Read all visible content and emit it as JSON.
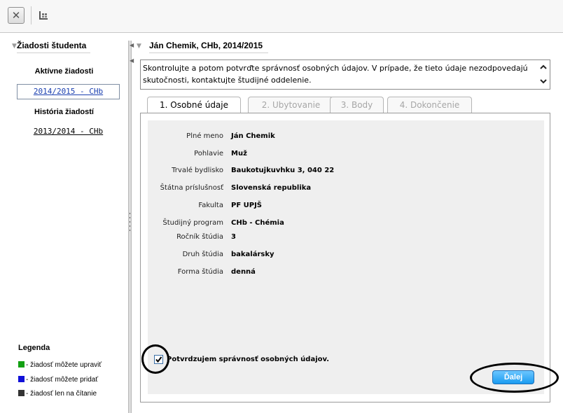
{
  "toolbar": {
    "close_icon": "close-icon",
    "grid_icon": "grid-icon"
  },
  "left": {
    "title": "Žiadosti študenta",
    "active_heading": "Aktívne žiadosti",
    "active_item": "2014/2015 - CHb",
    "history_heading": "História žiadostí",
    "history_item": "2013/2014 - CHb",
    "legend": {
      "title": "Legenda",
      "items": [
        {
          "color": "#12a012",
          "label": "- žiadosť  môžete upraviť"
        },
        {
          "color": "#1010d8",
          "label": "- žiadosť  môžete pridať"
        },
        {
          "color": "#333333",
          "label": "- žiadosť  len na čítanie"
        }
      ]
    }
  },
  "right": {
    "title": "Ján Chemik, CHb, 2014/2015",
    "info": "Skontrolujte a potom potvrďte správnosť osobných údajov. V prípade, že tieto údaje nezodpovedajú skutočnosti, kontaktujte študijné oddelenie.",
    "tabs": [
      "1. Osobné údaje",
      "2. Ubytovanie",
      "3. Body",
      "4. Dokončenie"
    ],
    "fields": [
      {
        "label": "Plné meno",
        "value": "Ján Chemik"
      },
      {
        "label": "Pohlavie",
        "value": "Muž"
      },
      {
        "label": "Trvalé bydlisko",
        "value": "Baukotujkuvhku 3, 040 22"
      },
      {
        "label": "Štátna príslušnosť",
        "value": "Slovenská republika"
      },
      {
        "label": "Fakulta",
        "value": "PF UPJŠ"
      },
      {
        "label": "Študijný program",
        "value": "CHb - Chémia"
      },
      {
        "label": "Ročník štúdia",
        "value": "3"
      },
      {
        "label": "Druh štúdia",
        "value": "bakalársky"
      },
      {
        "label": "Forma štúdia",
        "value": "denná"
      }
    ],
    "confirm_label": "Potvrdzujem správnosť osobných údajov.",
    "confirm_checked": true,
    "next_label": "Ďalej"
  }
}
